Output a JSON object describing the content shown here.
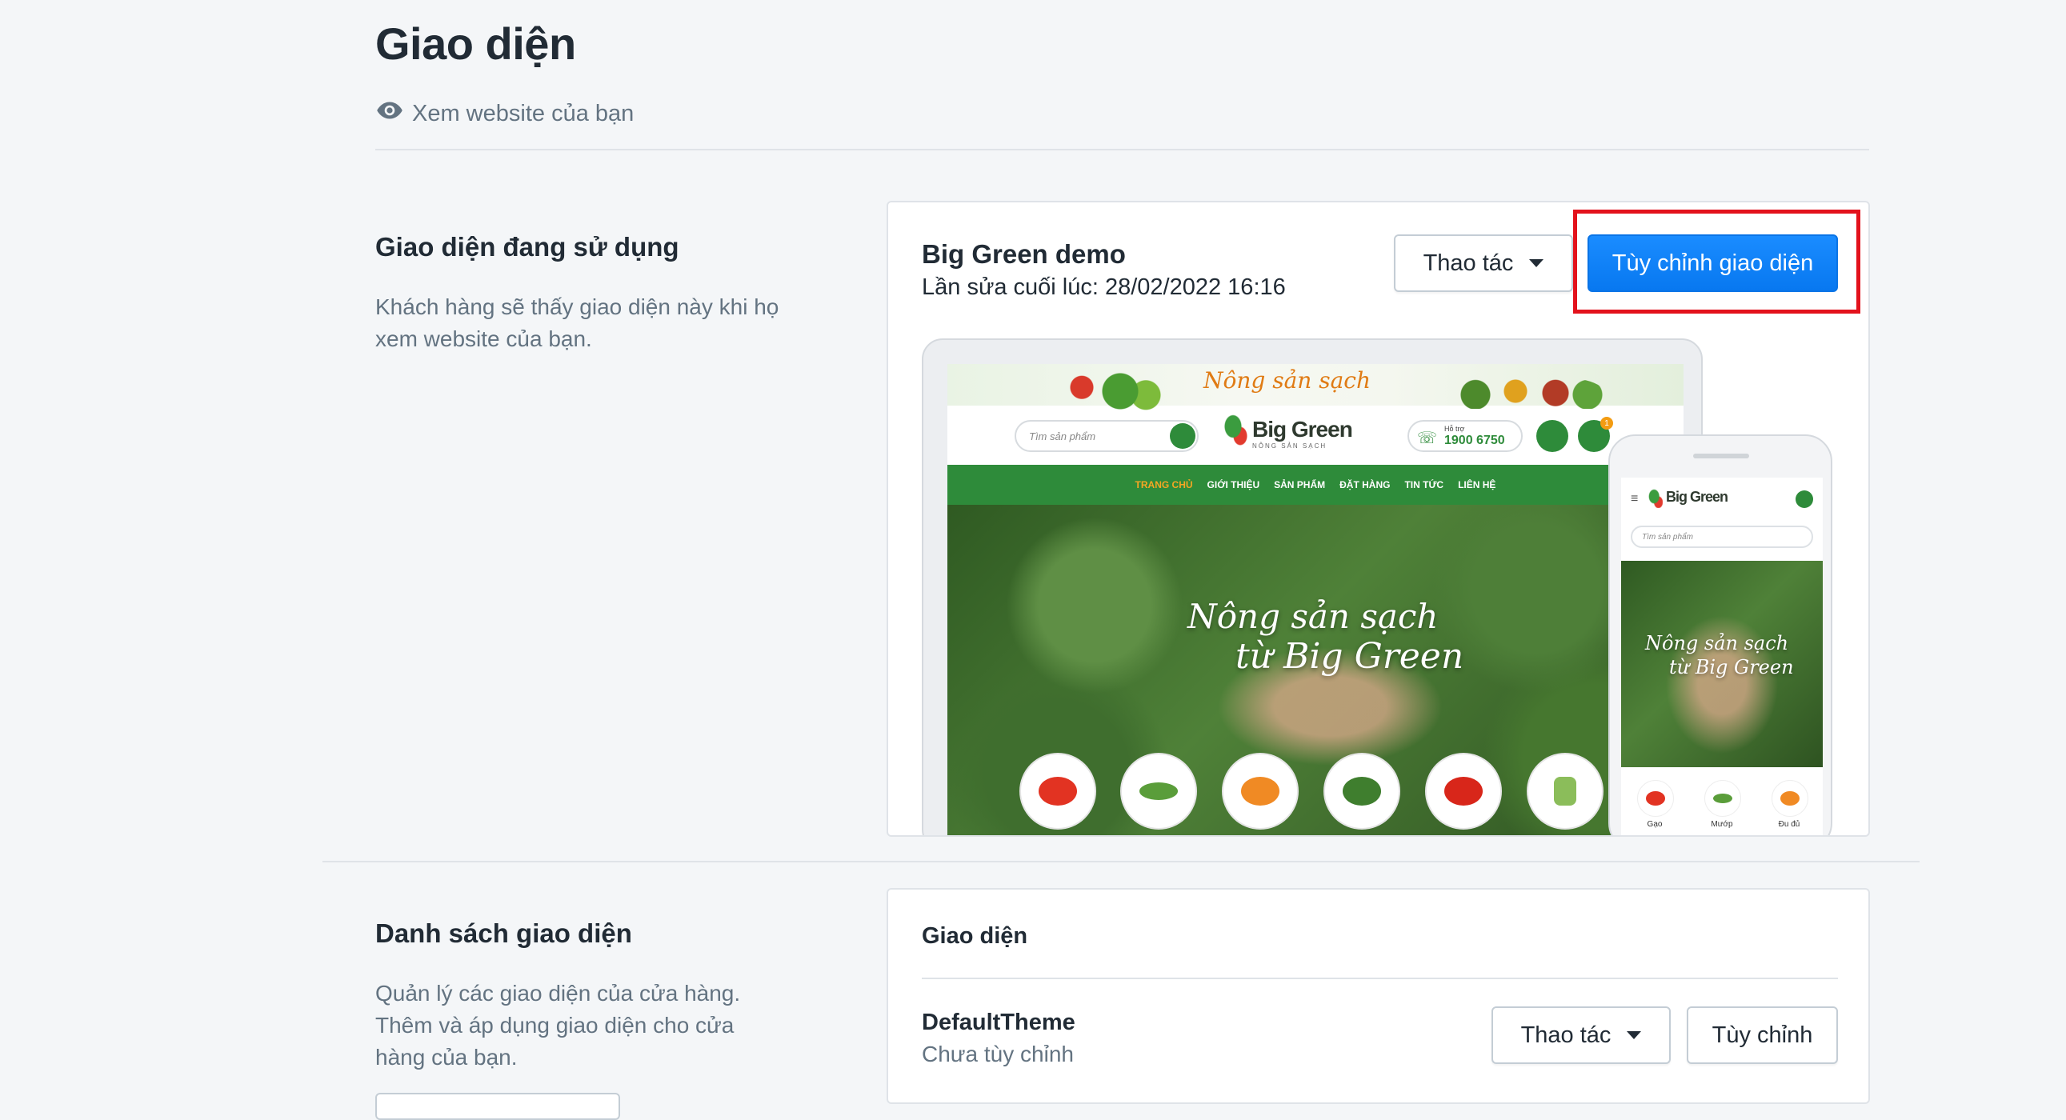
{
  "page": {
    "title": "Giao diện",
    "view_site": "Xem website của bạn"
  },
  "current_section": {
    "title": "Giao diện đang sử dụng",
    "description": "Khách hàng sẽ thấy giao diện này khi họ xem website của bạn.",
    "theme_name": "Big Green demo",
    "last_edit": "Lần sửa cuối lúc: 28/02/2022 16:16",
    "actions_label": "Thao tác",
    "customize_label": "Tùy chỉnh giao diện"
  },
  "preview": {
    "banner_text": "Nông sản sạch",
    "search_placeholder": "Tìm sản phẩm",
    "logo": "Big Green",
    "logo_sub": "NÔNG SẢN SẠCH",
    "hotline_label": "Hỗ trợ",
    "hotline_number": "1900 6750",
    "cart_count": "1",
    "nav": [
      "TRANG CHỦ",
      "GIỚI THIỆU",
      "SẢN PHẨM",
      "ĐẶT HÀNG",
      "TIN TỨC",
      "LIÊN HỆ"
    ],
    "hero_line1": "Nông sản sạch",
    "hero_line2": "từ Big Green",
    "mobile_categories": [
      "Gạo",
      "Mướp",
      "Đu đủ"
    ]
  },
  "list_section": {
    "title": "Danh sách giao diện",
    "description": "Quản lý các giao diện của cửa hàng. Thêm và áp dụng giao diện cho cửa hàng của bạn.",
    "card_title": "Giao diện",
    "themes": [
      {
        "name": "DefaultTheme",
        "status": "Chưa tùy chỉnh",
        "actions_label": "Thao tác",
        "customize_label": "Tùy chỉnh"
      }
    ]
  },
  "colors": {
    "primary": "#0a84ff",
    "highlight": "#e3121c",
    "brand_green": "#2e8b3a"
  }
}
